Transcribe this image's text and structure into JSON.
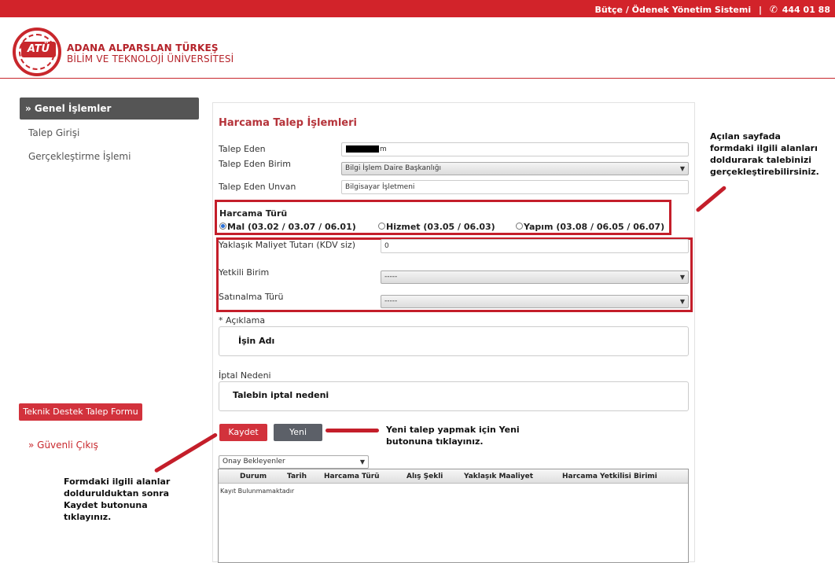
{
  "topbar": {
    "system_name": "Bütçe / Ödenek Yönetim Sistemi",
    "separator": "|",
    "phone": "444 01 88"
  },
  "brand": {
    "logo_text": "ATÜ",
    "line1": "ADANA ALPARSLAN TÜRKEŞ",
    "line2": "BİLİM VE TEKNOLOJİ ÜNİVERSİTESİ"
  },
  "sidebar": {
    "header": "» Genel İşlemler",
    "items": [
      {
        "label": "Talep Girişi"
      },
      {
        "label": "Gerçekleştirme İşlemi"
      }
    ],
    "support_button": "Teknik Destek Talep Formu",
    "logout": "» Güvenli Çıkış"
  },
  "form": {
    "title": "Harcama Talep İşlemleri",
    "talep_eden_label": "Talep Eden",
    "talep_eden_value": "m",
    "talep_eden_birim_label": "Talep Eden Birim",
    "talep_eden_birim_value": "Bilgi İşlem Daire Başkanlığı",
    "talep_eden_unvan_label": "Talep Eden Unvan",
    "talep_eden_unvan_value": "Bilgisayar İşletmeni",
    "harcama_turu_label": "Harcama Türü",
    "harcama_options": [
      {
        "label": "Mal (03.02 / 03.07 / 06.01)",
        "selected": true
      },
      {
        "label": "Hizmet (03.05 / 06.03)",
        "selected": false
      },
      {
        "label": "Yapım (03.08 / 06.05 / 06.07)",
        "selected": false
      }
    ],
    "maliyet_label": "Yaklaşık Maliyet Tutarı (KDV siz)",
    "maliyet_value": "0",
    "yetkili_birim_label": "Yetkili Birim",
    "yetkili_birim_value": "-----",
    "satinalma_label": "Satınalma Türü",
    "satinalma_value": "-----",
    "aciklama_label": "* Açıklama",
    "aciklama_value": "İşin Adı",
    "iptal_label": "İptal Nedeni",
    "iptal_value": "Talebin iptal nedeni",
    "save_button": "Kaydet",
    "new_button": "Yeni"
  },
  "grid": {
    "filter_value": "Onay Bekleyenler",
    "columns": [
      "Durum",
      "Tarih",
      "Harcama Türü",
      "Alış Şekli",
      "Yaklaşık Maaliyet",
      "Harcama Yetkilisi Birimi"
    ],
    "empty_text": "Kayıt Bulunmamaktadır"
  },
  "notes": {
    "right_lines": [
      "Açılan sayfada",
      "formdaki ilgili alanları",
      "doldurarak talebinizi",
      "gerçekleştirebilirsiniz."
    ],
    "yeni_lines": [
      "Yeni talep yapmak için Yeni",
      "butonuna tıklayınız."
    ],
    "kaydet_lines": [
      "Formdaki ilgili alanlar",
      "doldurulduktan sonra",
      "Kaydet butonuna",
      "tıklayınız."
    ]
  },
  "colors": {
    "brand_red": "#d2232a",
    "annotation_red": "#c41e2a",
    "menu_dark": "#555555"
  }
}
